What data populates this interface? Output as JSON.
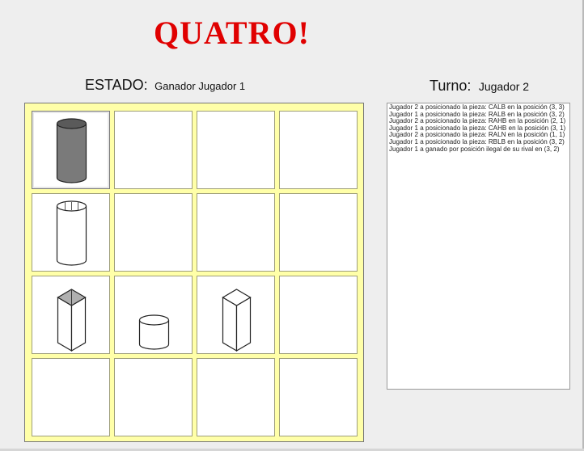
{
  "title": "QUATRO!",
  "status": {
    "label": "ESTADO:",
    "value": "Ganador Jugador 1"
  },
  "turn": {
    "label": "Turno:",
    "value": "Jugador 2"
  },
  "board": {
    "rows": 4,
    "cols": 4,
    "pieces": [
      {
        "row": 0,
        "col": 0,
        "shape": "cylinder",
        "size": "tall",
        "fill": "dark",
        "top": "solid",
        "selected": true
      },
      {
        "row": 1,
        "col": 0,
        "shape": "cylinder",
        "size": "tall",
        "fill": "light",
        "top": "hollow"
      },
      {
        "row": 2,
        "col": 0,
        "shape": "prism",
        "size": "tall",
        "fill": "light",
        "top": "hollow"
      },
      {
        "row": 2,
        "col": 1,
        "shape": "cylinder",
        "size": "short",
        "fill": "light",
        "top": "solid"
      },
      {
        "row": 2,
        "col": 2,
        "shape": "prism",
        "size": "tall",
        "fill": "light",
        "top": "solid"
      }
    ]
  },
  "log": [
    "Jugador 2 a posicionado la pieza: CALB en la posición (3, 3)",
    "Jugador 1 a posicionado la pieza: RALB en la posición (3, 2)",
    "Jugador 2 a posicionado la pieza: RAHB en la posición (2, 1)",
    "Jugador 1 a posicionado la pieza: CAHB en la posición (3, 1)",
    "Jugador 2 a posicionado la pieza: RALN en la posición (1, 1)",
    "Jugador 1 a posicionado la pieza: RBLB en la posición (3, 2)",
    "Jugador 1 a ganado por posición ilegal de su rival en  (3, 2)"
  ],
  "colors": {
    "title": "#e00000",
    "board_bg": "#ffffa8",
    "piece_dark": "#7a7a7a",
    "piece_light": "#ffffff",
    "piece_top_dark": "#b0b0b0"
  }
}
